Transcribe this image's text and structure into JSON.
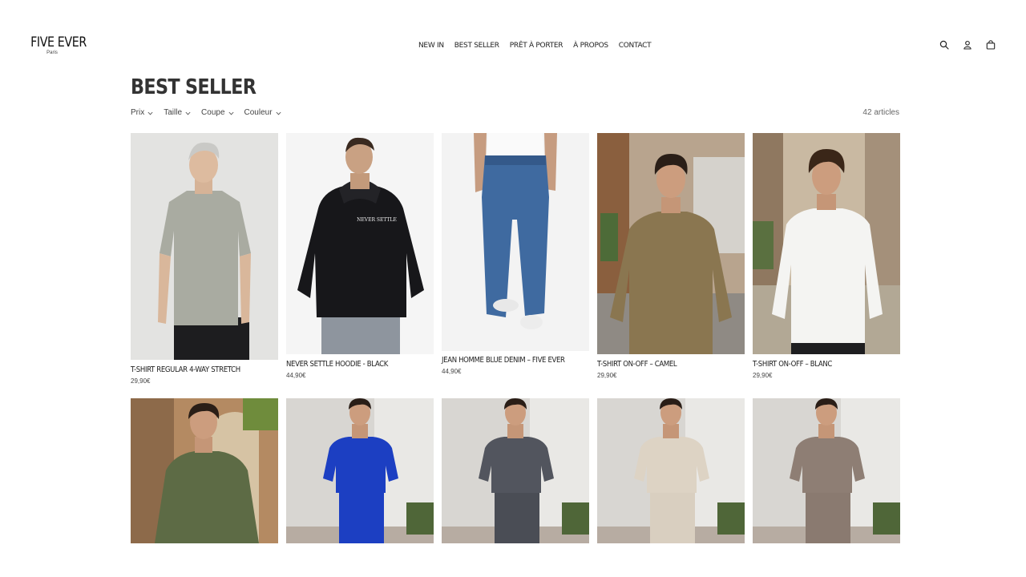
{
  "brand": {
    "name": "FIVE EVER",
    "tagline": "Paris"
  },
  "nav": [
    {
      "label": "NEW IN"
    },
    {
      "label": "BEST SELLER"
    },
    {
      "label": "PRÊT À PORTER"
    },
    {
      "label": "À PROPOS"
    },
    {
      "label": "CONTACT"
    }
  ],
  "header_icons": [
    "search-icon",
    "account-icon",
    "cart-icon"
  ],
  "page": {
    "title": "BEST SELLER",
    "article_count": "42 articles",
    "filters": [
      {
        "label": "Prix"
      },
      {
        "label": "Taille"
      },
      {
        "label": "Coupe"
      },
      {
        "label": "Couleur"
      }
    ]
  },
  "products": [
    {
      "name": "T-SHIRT REGULAR 4-WAY STRETCH",
      "price": "29,90€"
    },
    {
      "name": "NEVER SETTLE HOODIE - BLACK",
      "price": "44,90€",
      "print": "NEVER SETTLE"
    },
    {
      "name": "JEAN HOMME BLUE DENIM – FIVE EVER",
      "price": "44,90€"
    },
    {
      "name": "T-SHIRT ON-OFF – CAMEL",
      "price": "29,90€"
    },
    {
      "name": "T-SHIRT ON-OFF – BLANC",
      "price": "29,90€"
    },
    {
      "name": "",
      "price": ""
    },
    {
      "name": "",
      "price": ""
    },
    {
      "name": "",
      "price": ""
    },
    {
      "name": "",
      "price": ""
    },
    {
      "name": "",
      "price": ""
    }
  ],
  "colors": {
    "text": "#1a1a1a",
    "title": "#333333",
    "muted": "#666666",
    "sage_tee": "#a9aba1",
    "black_hoodie": "#17171a",
    "denim": "#3f6aa0",
    "camel_tee": "#8a7650",
    "white_tee": "#f4f4f2",
    "olive_tee": "#5d6b45",
    "royal_blue": "#1c3fc2",
    "charcoal": "#4a4d55",
    "beige": "#d9cfc0",
    "taupe": "#8a7a70"
  }
}
